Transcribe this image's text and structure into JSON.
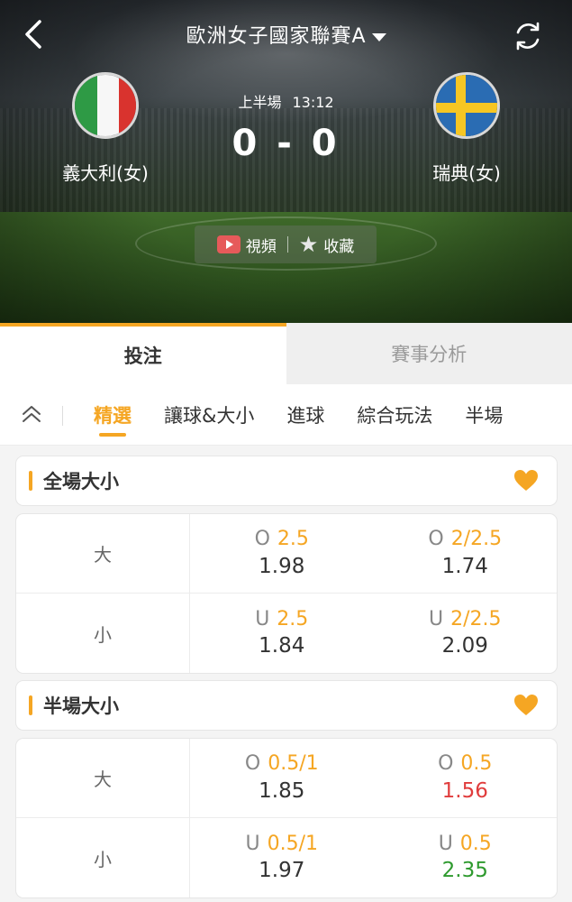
{
  "header": {
    "league_title": "歐洲女子國家聯賽A",
    "home_team": "義大利(女)",
    "away_team": "瑞典(女)",
    "period": "上半場",
    "clock": "13:12",
    "score": "0 - 0",
    "video_label": "視頻",
    "favorite_label": "收藏"
  },
  "main_tabs": [
    {
      "label": "投注",
      "active": true
    },
    {
      "label": "賽事分析",
      "active": false
    }
  ],
  "sub_tabs": [
    {
      "label": "精選",
      "active": true
    },
    {
      "label": "讓球&大小",
      "active": false
    },
    {
      "label": "進球",
      "active": false
    },
    {
      "label": "綜合玩法",
      "active": false
    },
    {
      "label": "半場",
      "active": false
    }
  ],
  "markets": [
    {
      "title": "全場大小",
      "rows": [
        {
          "label": "大",
          "cells": [
            {
              "prefix": "O",
              "handicap": "2.5",
              "price": "1.98",
              "trend": "none"
            },
            {
              "prefix": "O",
              "handicap": "2/2.5",
              "price": "1.74",
              "trend": "none"
            }
          ]
        },
        {
          "label": "小",
          "cells": [
            {
              "prefix": "U",
              "handicap": "2.5",
              "price": "1.84",
              "trend": "none"
            },
            {
              "prefix": "U",
              "handicap": "2/2.5",
              "price": "2.09",
              "trend": "none"
            }
          ]
        }
      ]
    },
    {
      "title": "半場大小",
      "rows": [
        {
          "label": "大",
          "cells": [
            {
              "prefix": "O",
              "handicap": "0.5/1",
              "price": "1.85",
              "trend": "none"
            },
            {
              "prefix": "O",
              "handicap": "0.5",
              "price": "1.56",
              "trend": "down"
            }
          ]
        },
        {
          "label": "小",
          "cells": [
            {
              "prefix": "U",
              "handicap": "0.5/1",
              "price": "1.97",
              "trend": "none"
            },
            {
              "prefix": "U",
              "handicap": "0.5",
              "price": "2.35",
              "trend": "up"
            }
          ]
        }
      ]
    }
  ],
  "colors": {
    "accent": "#f5a623",
    "price_down": "#e03c3c",
    "price_up": "#2e9a2e"
  },
  "icons": {
    "back": "chevron-left-icon",
    "refresh": "refresh-icon",
    "video": "video-play-icon",
    "favorite": "star-icon",
    "collapse": "double-chevron-up-icon",
    "market_favorite": "heart-icon"
  }
}
